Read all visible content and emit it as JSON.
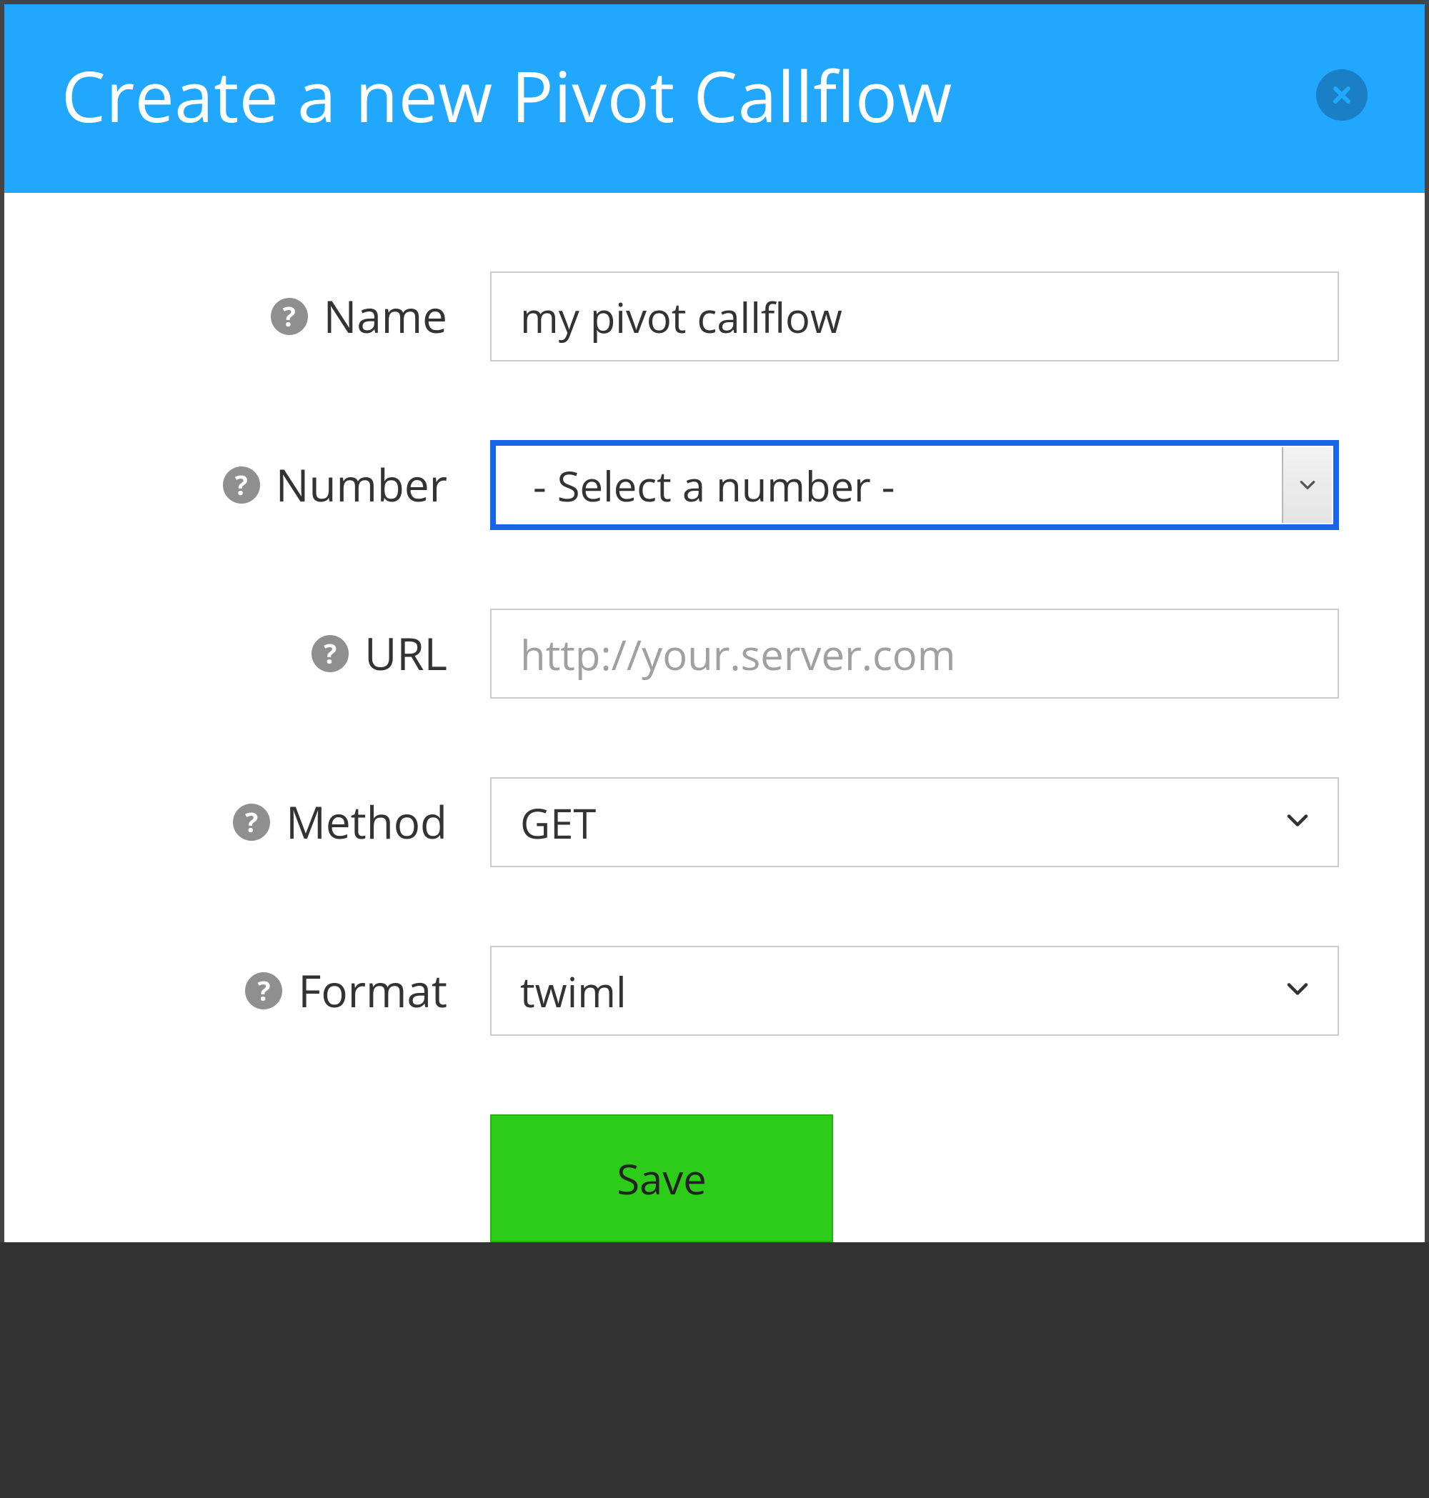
{
  "header": {
    "title": "Create a new Pivot Callflow"
  },
  "fields": {
    "name": {
      "label": "Name",
      "value": "my pivot callflow"
    },
    "number": {
      "label": "Number",
      "selected": "- Select a number -"
    },
    "url": {
      "label": "URL",
      "value": "",
      "placeholder": "http://your.server.com"
    },
    "method": {
      "label": "Method",
      "selected": "GET"
    },
    "format": {
      "label": "Format",
      "selected": "twiml"
    }
  },
  "buttons": {
    "save": "Save"
  },
  "icons": {
    "help_glyph": "?"
  }
}
